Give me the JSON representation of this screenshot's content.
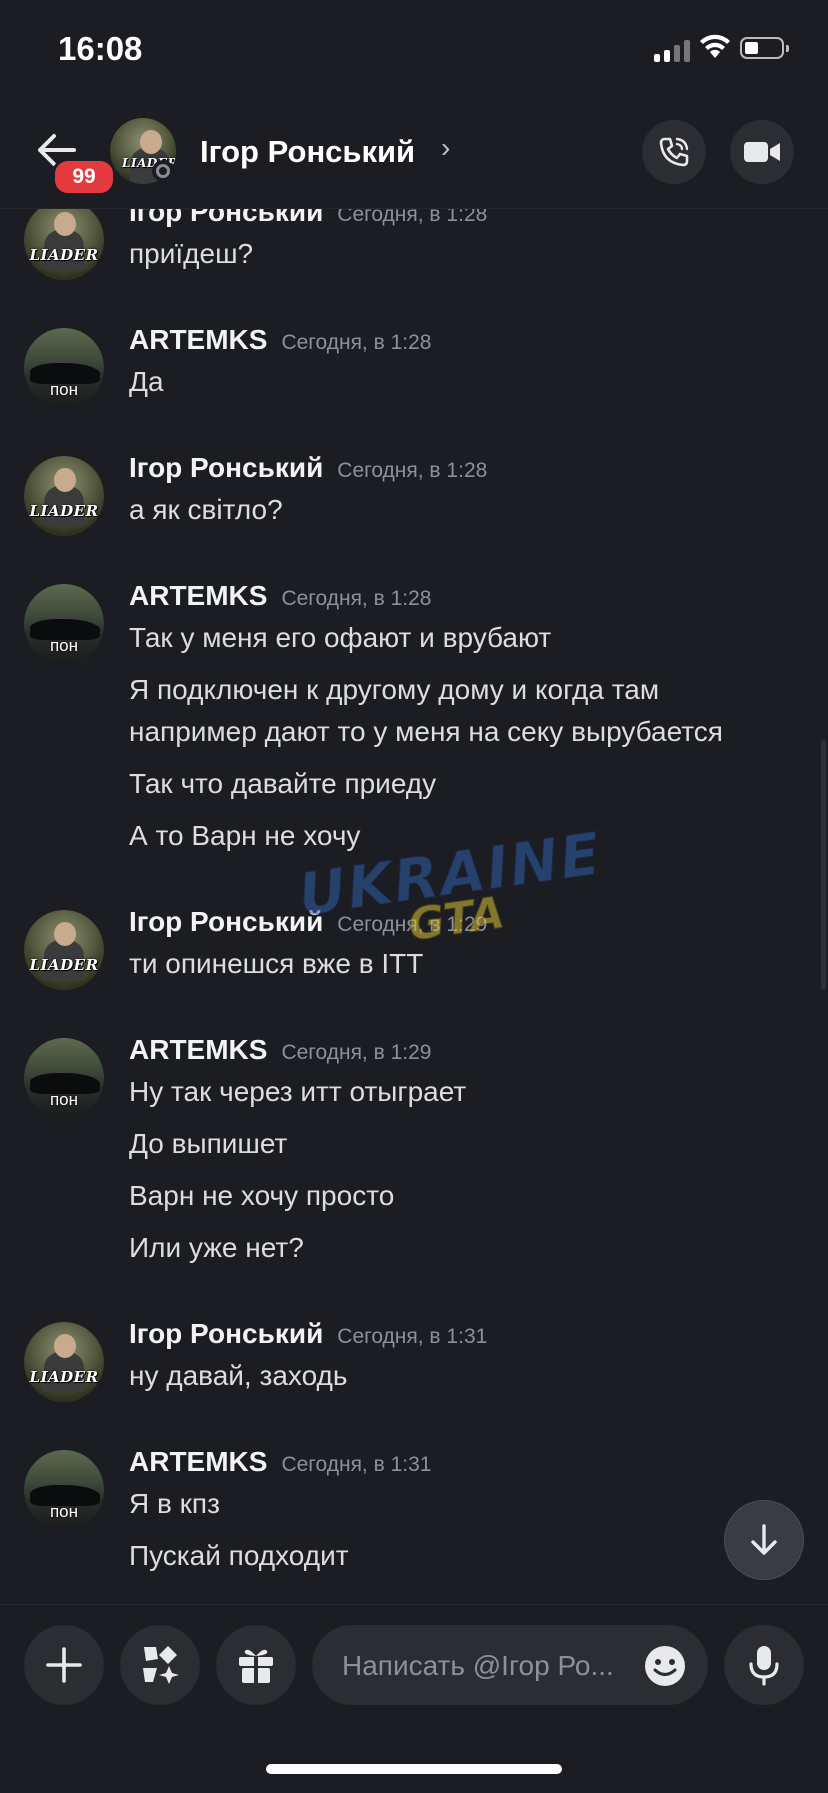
{
  "status_bar": {
    "time": "16:08"
  },
  "header": {
    "unread_badge": "99",
    "name": "Ігор Ронський",
    "chevron": "›",
    "avatar_label": "LIADER"
  },
  "avatars": {
    "igor_label": "LIADER",
    "artem_label": "пон"
  },
  "messages": [
    {
      "author": "Ігор Ронський",
      "time": "Сегодня, в 1:28",
      "lines": [
        "приїдеш?"
      ]
    },
    {
      "author": "ARTEMKS",
      "time": "Сегодня, в 1:28",
      "lines": [
        "Да"
      ]
    },
    {
      "author": "Ігор Ронський",
      "time": "Сегодня, в 1:28",
      "lines": [
        "а як світло?"
      ]
    },
    {
      "author": "ARTEMKS",
      "time": "Сегодня, в 1:28",
      "lines": [
        "Так у меня его офают и врубают",
        "Я подключен к другому дому и когда там",
        "например дают то у меня на секу вырубается",
        "Так что давайте приеду",
        "А то Варн не хочу"
      ]
    },
    {
      "author": "Ігор Ронський",
      "time": "Сегодня, в 1:29",
      "lines": [
        "ти опинешся вже в ІТТ"
      ]
    },
    {
      "author": "ARTEMKS",
      "time": "Сегодня, в 1:29",
      "lines": [
        "Ну так через итт отыграет",
        "До выпишет",
        "Варн не хочу просто",
        "Или уже нет?"
      ]
    },
    {
      "author": "Ігор Ронський",
      "time": "Сегодня, в 1:31",
      "lines": [
        "ну давай, заходь"
      ]
    },
    {
      "author": "ARTEMKS",
      "time": "Сегодня, в 1:31",
      "lines": [
        "Я в кпз",
        "Пускай подходит"
      ]
    }
  ],
  "watermark": {
    "line1": "UKRAINE",
    "line2": "GTA"
  },
  "composer": {
    "placeholder": "Написать @Ігор Ро..."
  }
}
